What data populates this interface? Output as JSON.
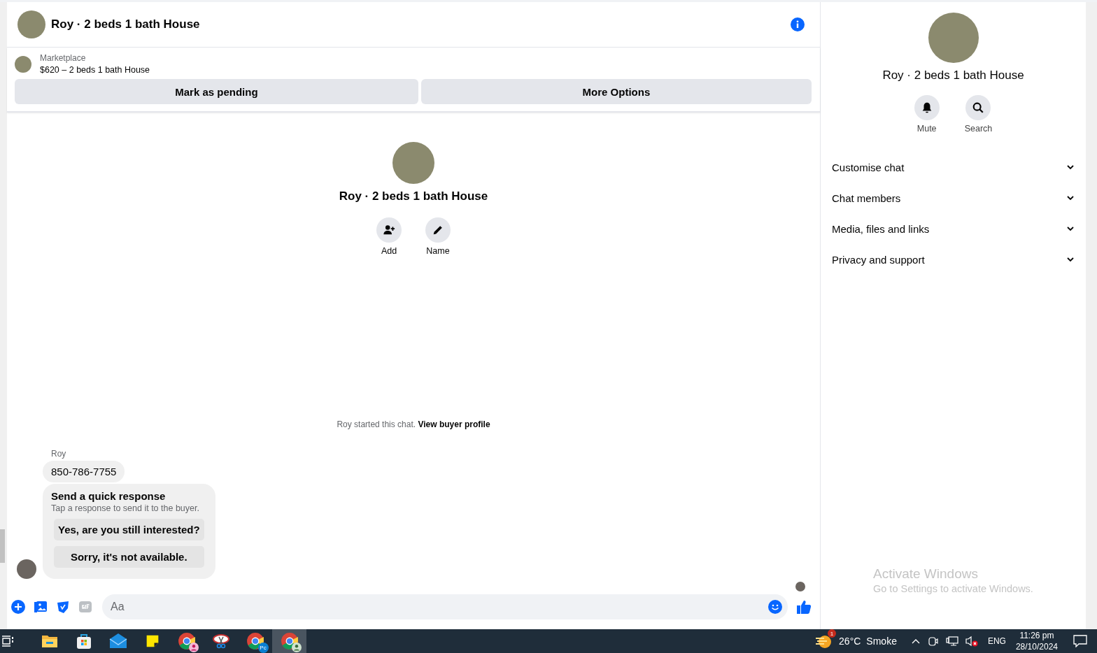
{
  "header": {
    "title": "Roy · 2 beds 1 bath House"
  },
  "listing": {
    "source": "Marketplace",
    "title": "$620 – 2 beds 1 bath House"
  },
  "listing_actions": [
    "Mark as pending",
    "More Options"
  ],
  "conversation": {
    "title": "Roy · 2 beds 1 bath House",
    "started_text": "Roy started this chat.",
    "started_link": "View buyer profile",
    "actions": [
      {
        "label": "Add",
        "kind": "add-person"
      },
      {
        "label": "Name",
        "kind": "pencil"
      }
    ]
  },
  "messages": {
    "sender": "Roy",
    "text": "850-786-7755",
    "quick_response": {
      "title": "Send a quick response",
      "subtitle": "Tap a response to send it to the buyer.",
      "options": [
        "Yes, are you still interested?",
        "Sorry, it's not available."
      ]
    }
  },
  "composer": {
    "placeholder": "Aa"
  },
  "details": {
    "title": "Roy · 2 beds 1 bath House",
    "actions": [
      {
        "label": "Mute",
        "kind": "bell"
      },
      {
        "label": "Search",
        "kind": "search"
      }
    ],
    "sections": [
      {
        "label": "Customise chat",
        "expanded": false
      },
      {
        "label": "Chat members",
        "expanded": false
      },
      {
        "label": "Media, files and links",
        "expanded": false
      },
      {
        "label": "Privacy and support",
        "expanded": false
      }
    ]
  },
  "activation_notice": {
    "title": "Activate Windows",
    "subtitle": "Go to Settings to activate Windows."
  },
  "taskbar": {
    "apps": [
      {
        "kind": "folder",
        "selected": false
      },
      {
        "kind": "store",
        "selected": false
      },
      {
        "kind": "mail",
        "selected": false
      },
      {
        "kind": "note",
        "selected": false
      },
      {
        "kind": "browser",
        "selected": false
      },
      {
        "kind": "scissors",
        "selected": false
      },
      {
        "kind": "browser",
        "badge": "Pc",
        "selected": false
      },
      {
        "kind": "browser",
        "selected": true
      }
    ],
    "weather": {
      "badge": "1",
      "temperature": "26°C",
      "condition": "Smoke"
    },
    "language": "ENG",
    "time": "11:26 pm",
    "date": "28/10/2024"
  }
}
